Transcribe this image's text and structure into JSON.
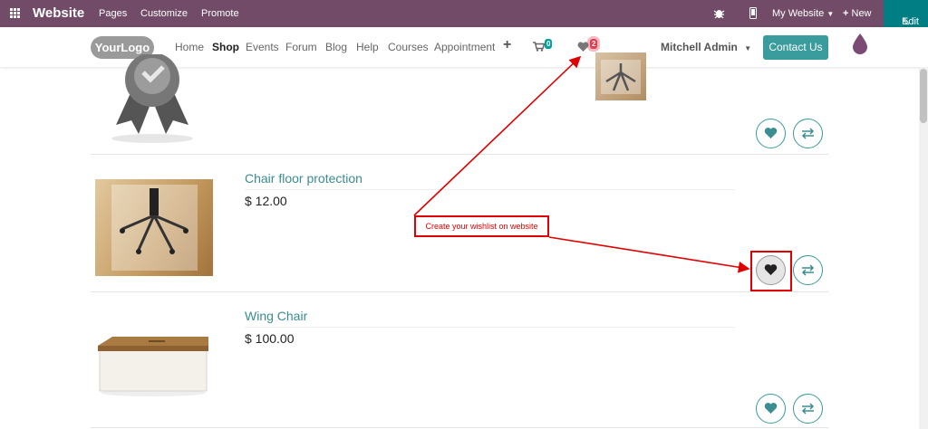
{
  "adminbar": {
    "brand": "Website",
    "menu": [
      "Pages",
      "Customize",
      "Promote"
    ],
    "site_selector": "My Website",
    "new_label": "New",
    "edit_label": "Edit"
  },
  "header": {
    "logo_text": "YourLogo",
    "nav": [
      "Home",
      "Shop",
      "Events",
      "Forum",
      "Blog",
      "Help",
      "Courses",
      "Appointment"
    ],
    "cart_count": "0",
    "wishlist_count": "2",
    "user": "Mitchell Admin",
    "contact_label": "Contact Us"
  },
  "products": [
    {
      "name": "Chair floor protection",
      "price": "$ 12.00"
    },
    {
      "name": "Wing Chair",
      "price": "$ 100.00"
    }
  ],
  "annotation": {
    "text": "Create your wishlist on website"
  },
  "colors": {
    "admin_bar": "#714b67",
    "accent": "#3a9c9d",
    "annotation": "#e00000"
  }
}
